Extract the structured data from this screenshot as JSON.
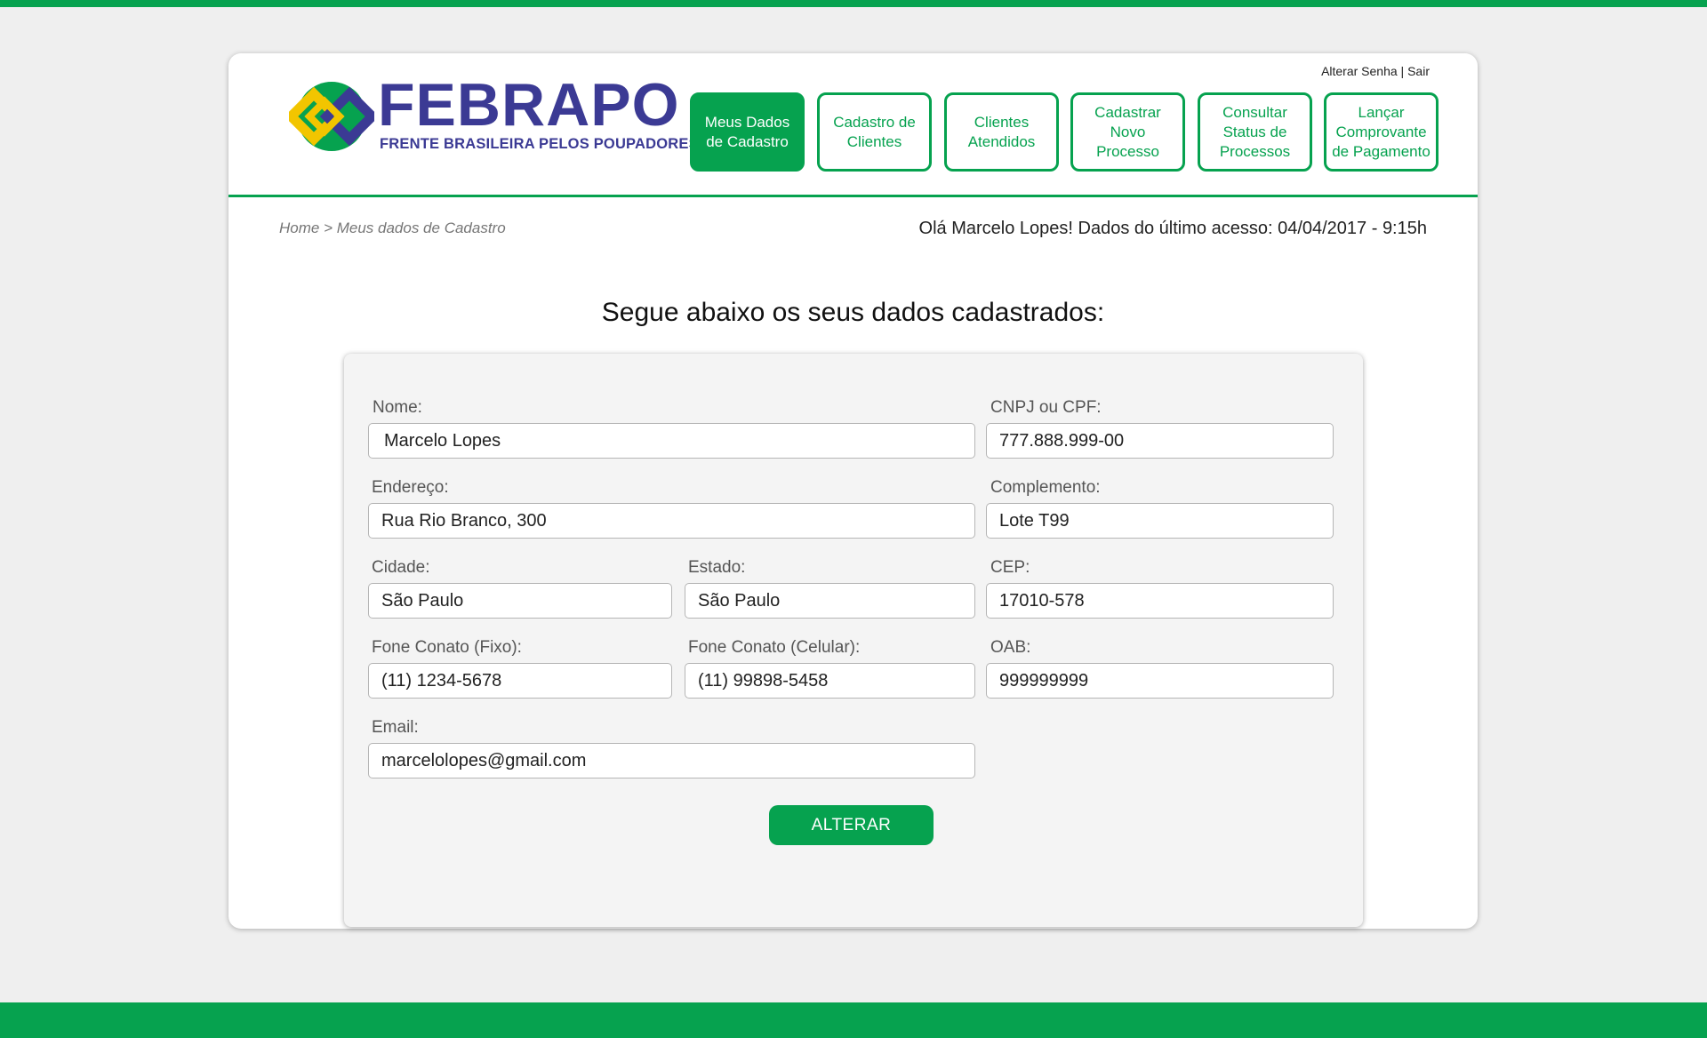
{
  "colors": {
    "brand_green": "#06a24f",
    "brand_blue": "#3b3a94",
    "brand_yellow": "#f2c500"
  },
  "logo": {
    "name": "FEBRAPO",
    "tagline": "FRENTE BRASILEIRA PELOS POUPADORES"
  },
  "utility": {
    "change_password": "Alterar Senha",
    "separator": " | ",
    "logout": "Sair"
  },
  "nav": {
    "items": [
      {
        "label": "Meus Dados de Cadastro",
        "active": true
      },
      {
        "label": "Cadastro de Clientes",
        "active": false
      },
      {
        "label": "Clientes Atendidos",
        "active": false
      },
      {
        "label": "Cadastrar Novo Processo",
        "active": false
      },
      {
        "label": "Consultar Status de Processos",
        "active": false
      },
      {
        "label": "Lançar Comprovante de Pagamento",
        "active": false
      }
    ]
  },
  "breadcrumb": "Home > Meus dados de Cadastro",
  "last_access": "Olá Marcelo Lopes! Dados do último acesso: 04/04/2017 - 9:15h",
  "section_title": "Segue abaixo os seus dados cadastrados:",
  "form": {
    "nome": {
      "label": "Nome:",
      "value": "Marcelo Lopes"
    },
    "cnpj": {
      "label": "CNPJ ou CPF:",
      "value": "777.888.999-00"
    },
    "endereco": {
      "label": "Endereço:",
      "value": "Rua Rio Branco, 300"
    },
    "complemento": {
      "label": "Complemento:",
      "value": "Lote T99"
    },
    "cidade": {
      "label": "Cidade:",
      "value": "São Paulo"
    },
    "estado": {
      "label": "Estado:",
      "value": "São Paulo"
    },
    "cep": {
      "label": "CEP:",
      "value": "17010-578"
    },
    "fone_fixo": {
      "label": "Fone Conato (Fixo):",
      "value": "(11) 1234-5678"
    },
    "fone_celular": {
      "label": "Fone Conato (Celular):",
      "value": "(11) 99898-5458"
    },
    "oab": {
      "label": "OAB:",
      "value": "999999999"
    },
    "email": {
      "label": "Email:",
      "value": "marcelolopes@gmail.com"
    },
    "submit_label": "ALTERAR"
  }
}
